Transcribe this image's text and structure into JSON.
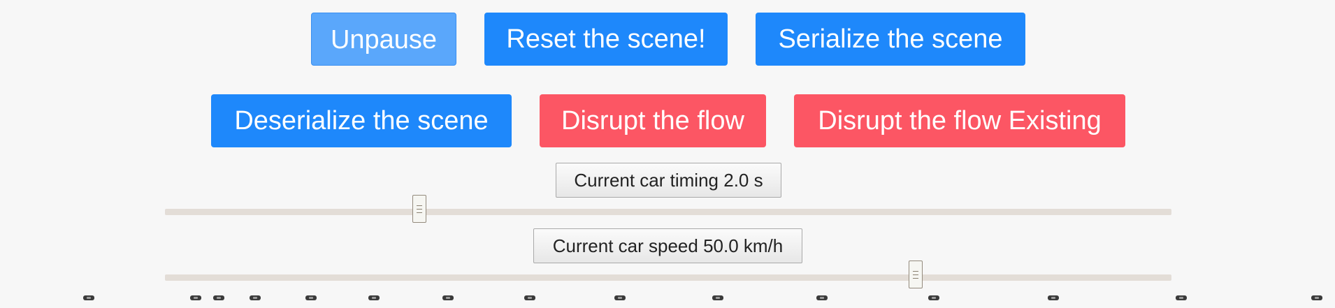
{
  "controls": {
    "unpause_label": "Unpause",
    "reset_label": "Reset the scene!",
    "serialize_label": "Serialize the scene",
    "deserialize_label": "Deserialize the scene",
    "disrupt_label": "Disrupt the flow",
    "disrupt_existing_label": "Disrupt the flow Existing"
  },
  "timing": {
    "label": "Current car timing 2.0 s",
    "slider_fraction": 0.253
  },
  "speed": {
    "label": "Current car speed 50.0 km/h",
    "slider_fraction": 0.746
  },
  "colors": {
    "primary": "#1e88fb",
    "primary_hover": "#5aa7fb",
    "danger": "#fc5664",
    "background": "#f7f7f7",
    "slider_track": "#e3ddd7"
  },
  "cars": {
    "count": 15,
    "icon": "car-icon"
  }
}
